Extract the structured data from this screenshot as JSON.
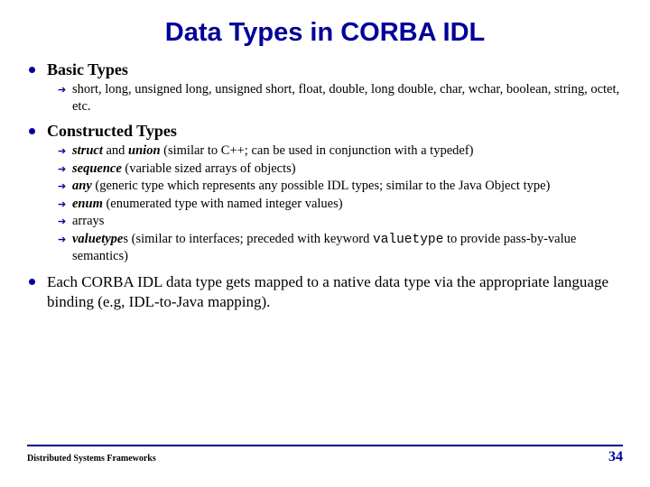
{
  "title": "Data Types in CORBA IDL",
  "sections": [
    {
      "heading": "Basic Types",
      "items": [
        {
          "html": "short, long, unsigned long, unsigned short, float, double, long double, char, wchar, boolean, string, octet, etc."
        }
      ]
    },
    {
      "heading": "Constructed Types",
      "items": [
        {
          "html": "<strong class='kw'>struct</strong> and <strong class='kw'>union</strong> (similar to C++; can be used in conjunction with a typedef)"
        },
        {
          "html": "<strong class='kw'>sequence</strong> (variable sized arrays of objects)"
        },
        {
          "html": "<strong class='kw'>any</strong> (generic type which represents any possible IDL types; similar to the Java Object type)"
        },
        {
          "html": "<strong class='kw'>enum</strong> (enumerated type with named integer values)"
        },
        {
          "html": "arrays"
        },
        {
          "html": "<strong class='kw'>valuetype</strong>s (similar to interfaces; preceded with keyword <span class='mono'>valuetype</span> to provide pass-by-value semantics)"
        }
      ]
    },
    {
      "body": "Each CORBA IDL data type gets mapped to a native data type via the appropriate language binding (e.g, IDL-to-Java mapping)."
    }
  ],
  "footer": {
    "left": "Distributed Systems Frameworks",
    "page": "34"
  }
}
